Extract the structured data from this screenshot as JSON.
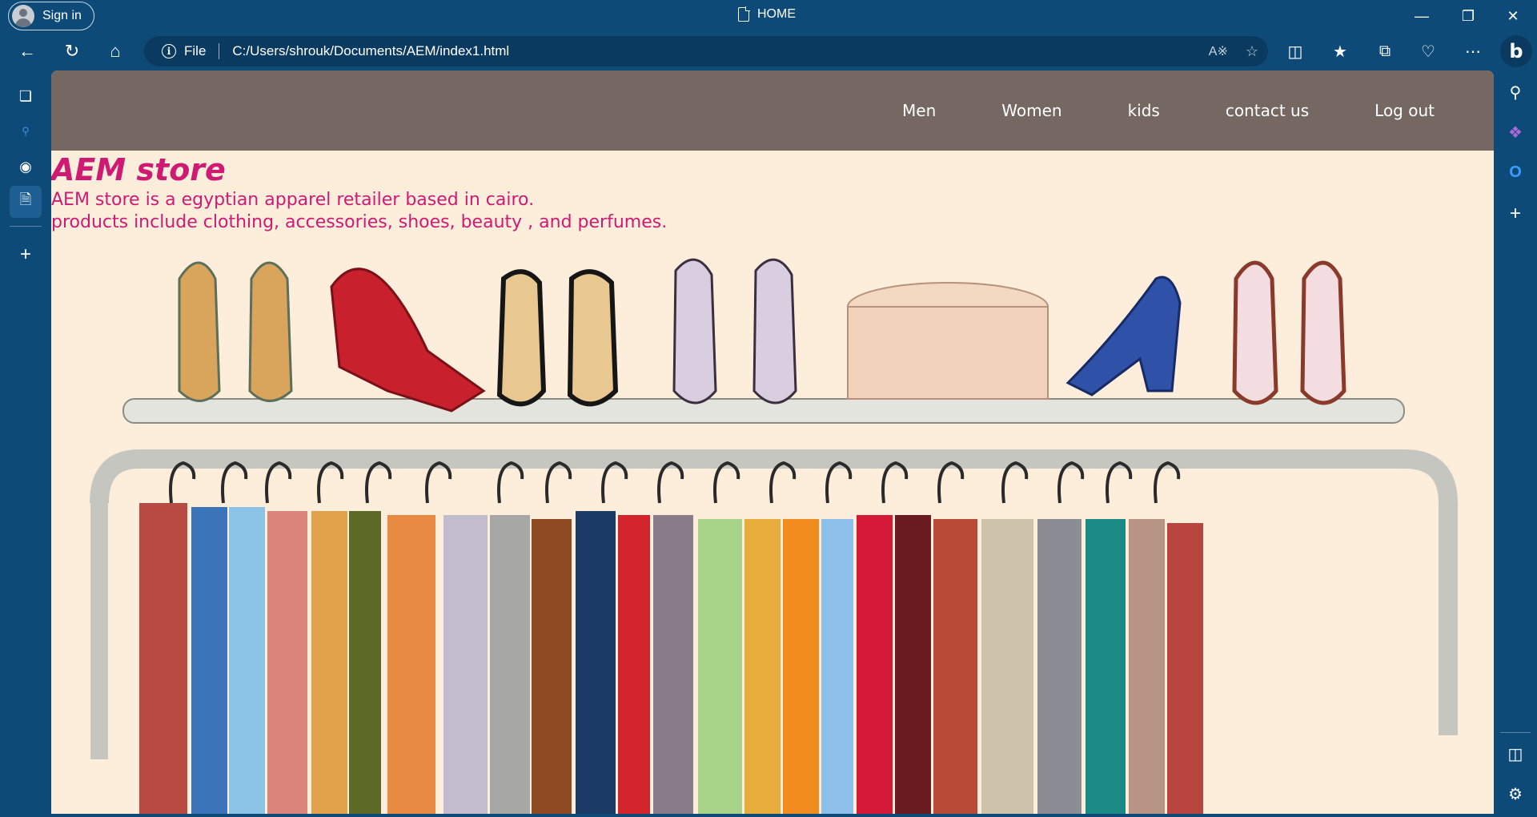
{
  "browser": {
    "sign_in_label": "Sign in",
    "tab_title": "HOME",
    "address_scheme_label": "File",
    "address_url": "C:/Users/shrouk/Documents/AEM/index1.html"
  },
  "site": {
    "nav": [
      "Men",
      "Women",
      "kids",
      "contact us",
      "Log out"
    ],
    "title": "AEM store",
    "description_line1": "AEM store is a egyptian apparel retailer based in cairo.",
    "description_line2": "products include clothing, accessories, shoes, beauty , and perfumes."
  },
  "colors": {
    "browser_chrome": "#0e4a77",
    "site_nav": "#756862",
    "accent_text": "#cf1a73",
    "page_background": "#fdeedc"
  }
}
